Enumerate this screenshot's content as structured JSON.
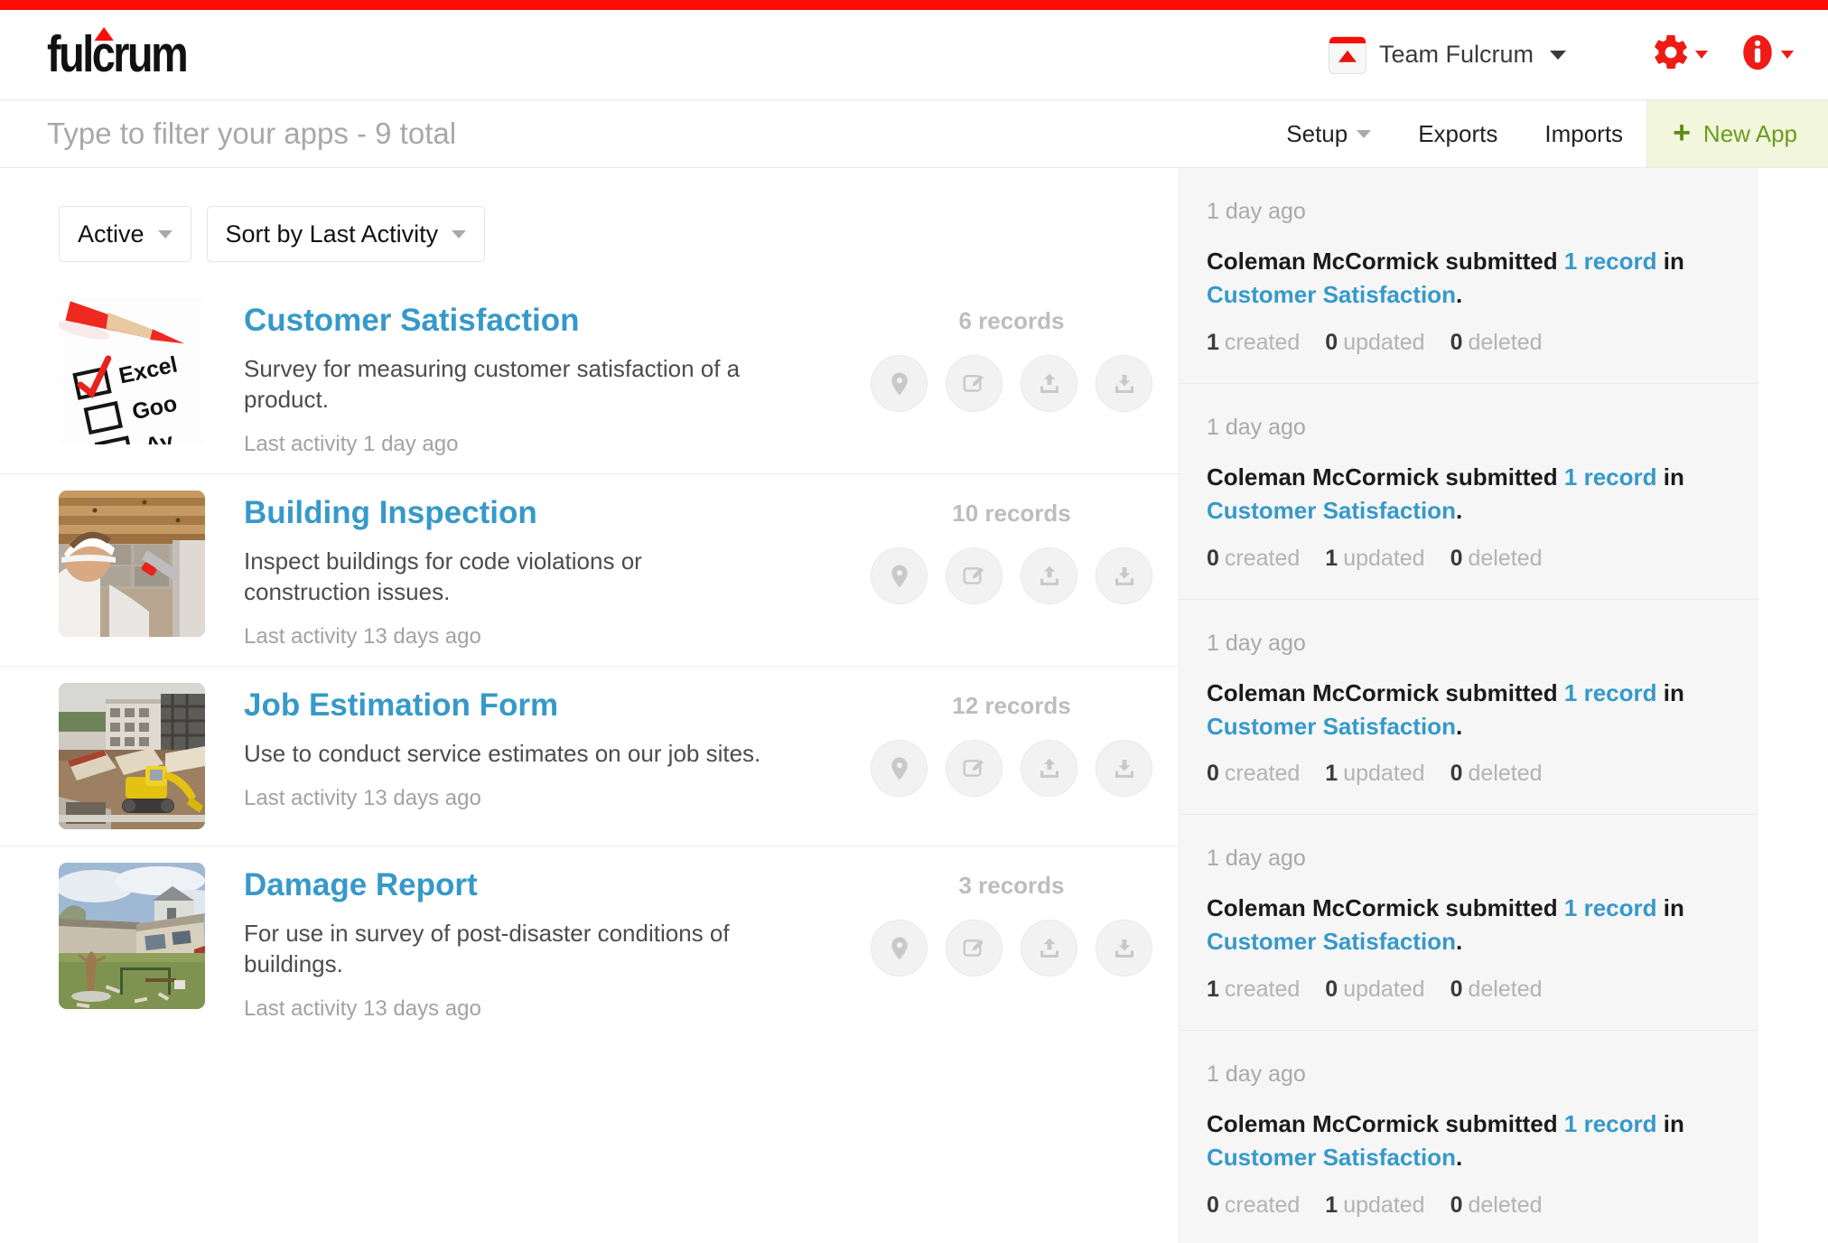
{
  "brand": {
    "logo_text": "fulcrum",
    "accent_red": "#fc0d06",
    "link_blue": "#3699c9",
    "green": "#6b9c1c"
  },
  "header": {
    "team_name": "Team Fulcrum",
    "settings_icon": "gear-icon",
    "help_icon": "info-icon"
  },
  "subheader": {
    "filter_placeholder": "Type to filter your apps - 9 total",
    "nav": [
      {
        "label": "Setup",
        "has_caret": true
      },
      {
        "label": "Exports",
        "has_caret": false
      },
      {
        "label": "Imports",
        "has_caret": false
      }
    ],
    "new_app_label": "New App",
    "new_app_plus": "+"
  },
  "filters": {
    "status_label": "Active",
    "sort_label": "Sort by Last Activity"
  },
  "apps": [
    {
      "title": "Customer Satisfaction",
      "description": "Survey for measuring customer satisfaction of a product.",
      "last_activity": "Last activity 1 day ago",
      "records": "6 records",
      "thumb": "survey-checklist-pencil"
    },
    {
      "title": "Building Inspection",
      "description": "Inspect buildings for code violations or construction issues.",
      "last_activity": "Last activity 13 days ago",
      "records": "10 records",
      "thumb": "inspector-hardhat-joists"
    },
    {
      "title": "Job Estimation Form",
      "description": "Use to conduct service estimates on our job sites.",
      "last_activity": "Last activity 13 days ago",
      "records": "12 records",
      "thumb": "construction-site-excavator"
    },
    {
      "title": "Damage Report",
      "description": "For use in survey of post-disaster conditions of buildings.",
      "last_activity": "Last activity 13 days ago",
      "records": "3 records",
      "thumb": "storm-damaged-house"
    }
  ],
  "app_actions": [
    {
      "name": "map-pin-icon",
      "label": "View on map"
    },
    {
      "name": "edit-icon",
      "label": "Edit app"
    },
    {
      "name": "upload-icon",
      "label": "Import records"
    },
    {
      "name": "download-icon",
      "label": "Export records"
    }
  ],
  "activity": [
    {
      "time": "1 day ago",
      "user": "Coleman McCormick",
      "verb": "submitted",
      "record_link": "1 record",
      "preposition": "in",
      "app_link": "Customer Satisfaction",
      "period": ".",
      "created": "1",
      "created_label": "created",
      "updated": "0",
      "updated_label": "updated",
      "deleted": "0",
      "deleted_label": "deleted"
    },
    {
      "time": "1 day ago",
      "user": "Coleman McCormick",
      "verb": "submitted",
      "record_link": "1 record",
      "preposition": "in",
      "app_link": "Customer Satisfaction",
      "period": ".",
      "created": "0",
      "created_label": "created",
      "updated": "1",
      "updated_label": "updated",
      "deleted": "0",
      "deleted_label": "deleted"
    },
    {
      "time": "1 day ago",
      "user": "Coleman McCormick",
      "verb": "submitted",
      "record_link": "1 record",
      "preposition": "in",
      "app_link": "Customer Satisfaction",
      "period": ".",
      "created": "0",
      "created_label": "created",
      "updated": "1",
      "updated_label": "updated",
      "deleted": "0",
      "deleted_label": "deleted"
    },
    {
      "time": "1 day ago",
      "user": "Coleman McCormick",
      "verb": "submitted",
      "record_link": "1 record",
      "preposition": "in",
      "app_link": "Customer Satisfaction",
      "period": ".",
      "created": "1",
      "created_label": "created",
      "updated": "0",
      "updated_label": "updated",
      "deleted": "0",
      "deleted_label": "deleted"
    },
    {
      "time": "1 day ago",
      "user": "Coleman McCormick",
      "verb": "submitted",
      "record_link": "1 record",
      "preposition": "in",
      "app_link": "Customer Satisfaction",
      "period": ".",
      "created": "0",
      "created_label": "created",
      "updated": "1",
      "updated_label": "updated",
      "deleted": "0",
      "deleted_label": "deleted"
    }
  ]
}
